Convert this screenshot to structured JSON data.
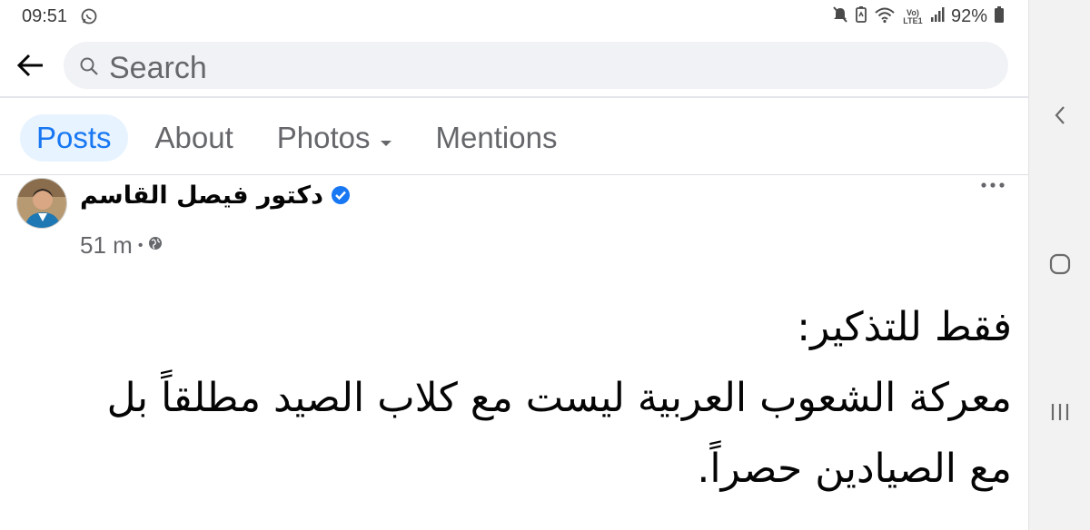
{
  "status_bar": {
    "time": "09:51",
    "battery": "92%",
    "network": "Vo) LTE1",
    "icons": [
      "whatsapp-icon",
      "mute-icon",
      "battery-saver-icon",
      "wifi-icon",
      "signal-icon",
      "battery-icon"
    ]
  },
  "search": {
    "placeholder": "Search"
  },
  "tabs": [
    {
      "label": "Posts",
      "active": true
    },
    {
      "label": "About",
      "active": false
    },
    {
      "label": "Photos",
      "active": false,
      "has_dropdown": true
    },
    {
      "label": "Mentions",
      "active": false
    }
  ],
  "post": {
    "author": "دكتور فيصل القاسم",
    "verified": true,
    "time": "51 m",
    "privacy_icon": "globe-icon",
    "body_lines": [
      "فقط للتذكير:",
      "معركة الشعوب العربية ليست مع كلاب الصيد مطلقاً بل",
      "مع الصيادين حصراً."
    ]
  },
  "colors": {
    "accent": "#1877f2",
    "tab_active_bg": "#e7f3ff",
    "secondary_text": "#65676b",
    "search_bg": "#f0f2f5",
    "nav_bg": "#f2f2f2"
  }
}
